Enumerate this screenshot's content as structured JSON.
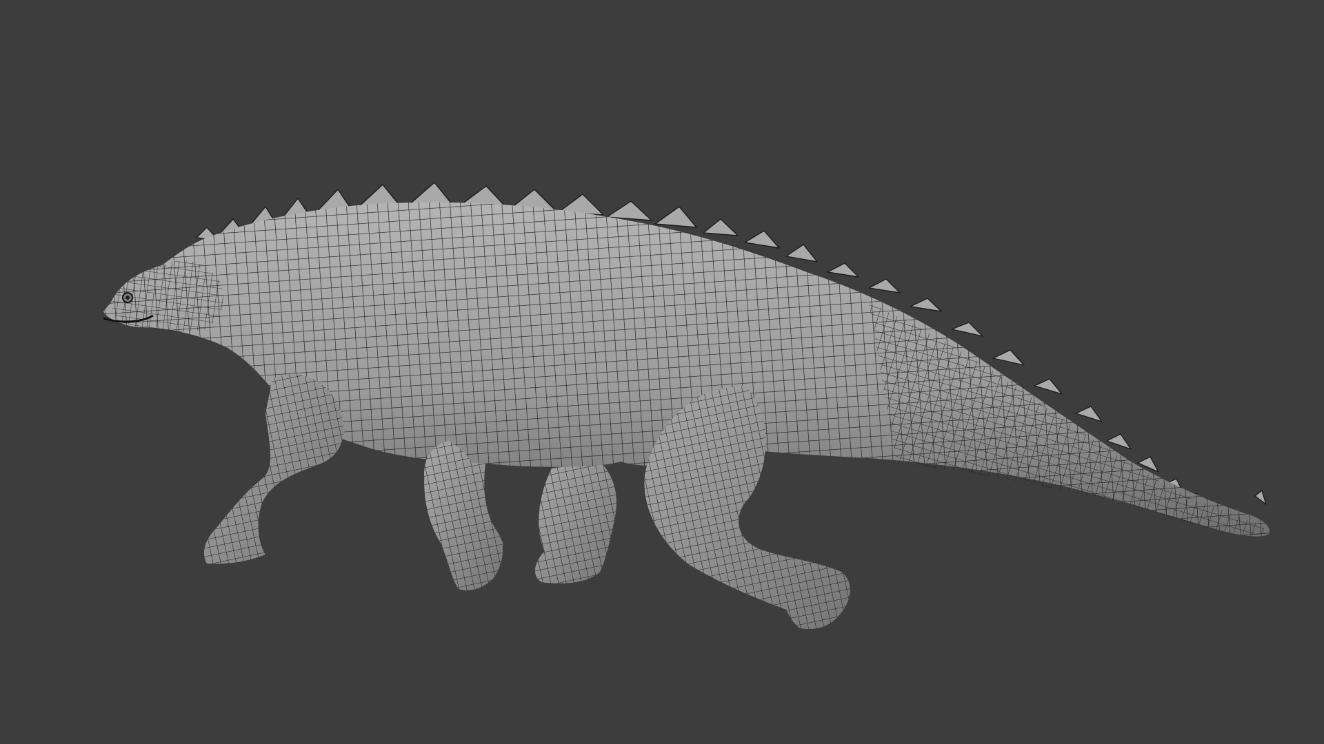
{
  "viewport": {
    "background_color": "#3d3d3d",
    "content": "none"
  },
  "model": {
    "display_mode": "wireframe-on-shaded",
    "surface_color": "#9a9a9a",
    "wire_color": "#1e1e1e",
    "shadow_color": "#6e6e6e",
    "highlight_color": "#bdbdbd"
  }
}
